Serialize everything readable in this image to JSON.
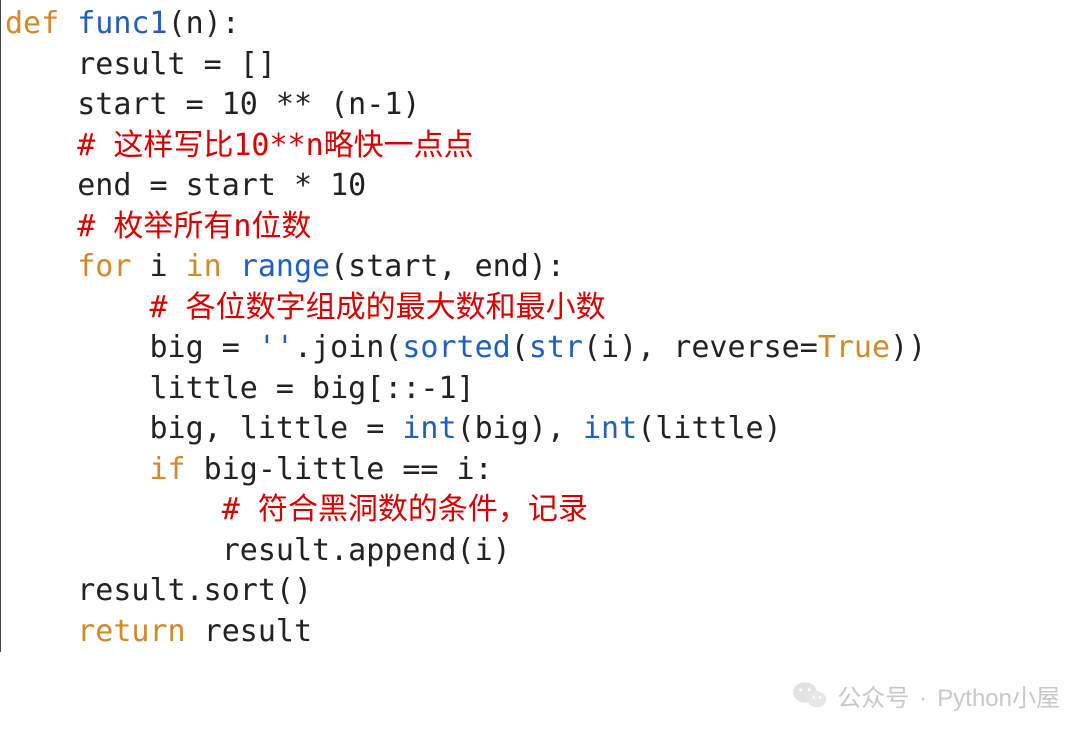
{
  "code": {
    "lines": [
      {
        "indent": 0,
        "tokens": [
          {
            "cls": "tok-def",
            "text": "def"
          },
          {
            "cls": "tok-txt",
            "text": " "
          },
          {
            "cls": "tok-func",
            "text": "func1"
          },
          {
            "cls": "tok-txt",
            "text": "(n):"
          }
        ]
      },
      {
        "indent": 1,
        "tokens": [
          {
            "cls": "tok-txt",
            "text": "result = []"
          }
        ]
      },
      {
        "indent": 1,
        "tokens": [
          {
            "cls": "tok-txt",
            "text": "start = 10 ** (n-1)"
          }
        ]
      },
      {
        "indent": 1,
        "tokens": [
          {
            "cls": "tok-cmt",
            "text": "# 这样写比10**n略快一点点"
          }
        ]
      },
      {
        "indent": 1,
        "tokens": [
          {
            "cls": "tok-txt",
            "text": "end = start * 10"
          }
        ]
      },
      {
        "indent": 1,
        "tokens": [
          {
            "cls": "tok-cmt",
            "text": "# 枚举所有n位数"
          }
        ]
      },
      {
        "indent": 1,
        "tokens": [
          {
            "cls": "tok-for",
            "text": "for"
          },
          {
            "cls": "tok-txt",
            "text": " i "
          },
          {
            "cls": "tok-in",
            "text": "in"
          },
          {
            "cls": "tok-txt",
            "text": " "
          },
          {
            "cls": "tok-func",
            "text": "range"
          },
          {
            "cls": "tok-txt",
            "text": "(start, end):"
          }
        ]
      },
      {
        "indent": 2,
        "tokens": [
          {
            "cls": "tok-cmt",
            "text": "# 各位数字组成的最大数和最小数"
          }
        ]
      },
      {
        "indent": 2,
        "tokens": [
          {
            "cls": "tok-txt",
            "text": "big = "
          },
          {
            "cls": "tok-str",
            "text": "''"
          },
          {
            "cls": "tok-txt",
            "text": ".join("
          },
          {
            "cls": "tok-func",
            "text": "sorted"
          },
          {
            "cls": "tok-txt",
            "text": "("
          },
          {
            "cls": "tok-func",
            "text": "str"
          },
          {
            "cls": "tok-txt",
            "text": "(i), reverse="
          },
          {
            "cls": "tok-kw",
            "text": "True"
          },
          {
            "cls": "tok-txt",
            "text": "))"
          }
        ]
      },
      {
        "indent": 2,
        "tokens": [
          {
            "cls": "tok-txt",
            "text": "little = big[::-1]"
          }
        ]
      },
      {
        "indent": 2,
        "tokens": [
          {
            "cls": "tok-txt",
            "text": "big, little = "
          },
          {
            "cls": "tok-func",
            "text": "int"
          },
          {
            "cls": "tok-txt",
            "text": "(big), "
          },
          {
            "cls": "tok-func",
            "text": "int"
          },
          {
            "cls": "tok-txt",
            "text": "(little)"
          }
        ]
      },
      {
        "indent": 2,
        "tokens": [
          {
            "cls": "tok-if",
            "text": "if"
          },
          {
            "cls": "tok-txt",
            "text": " big-little == i:"
          }
        ]
      },
      {
        "indent": 3,
        "tokens": [
          {
            "cls": "tok-cmt",
            "text": "# 符合黑洞数的条件，记录"
          }
        ]
      },
      {
        "indent": 3,
        "tokens": [
          {
            "cls": "tok-txt",
            "text": "result.append(i)"
          }
        ]
      },
      {
        "indent": 1,
        "tokens": [
          {
            "cls": "tok-txt",
            "text": "result.sort()"
          }
        ]
      },
      {
        "indent": 1,
        "tokens": [
          {
            "cls": "tok-ret",
            "text": "return"
          },
          {
            "cls": "tok-txt",
            "text": " result"
          }
        ]
      }
    ],
    "indent_unit": "    "
  },
  "watermark": {
    "label": "公众号",
    "sep": "·",
    "name": "Python小屋"
  }
}
